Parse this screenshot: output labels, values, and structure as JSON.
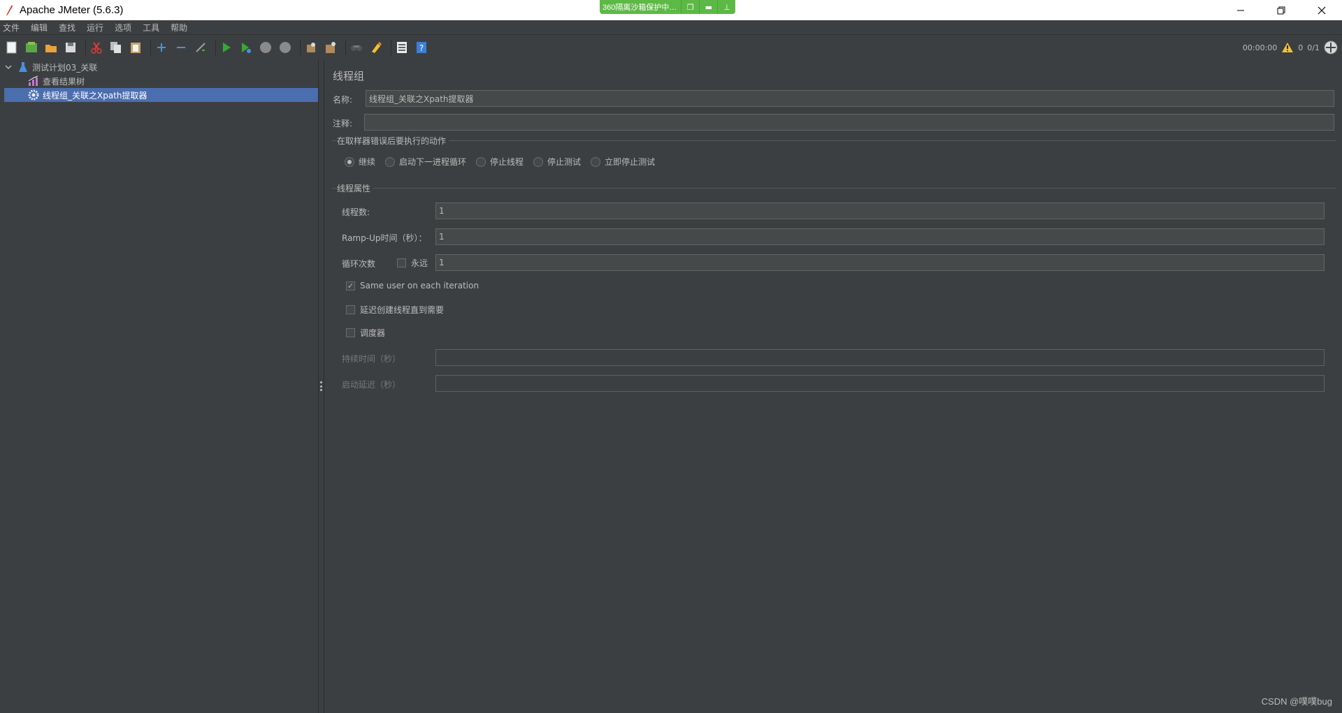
{
  "window": {
    "title": "Apache JMeter (5.6.3)",
    "sandbox_text": "360隔离沙箱保护中…"
  },
  "menu": [
    "文件",
    "编辑",
    "查找",
    "运行",
    "选项",
    "工具",
    "帮助"
  ],
  "toolbar": {
    "icons": [
      "new-icon",
      "templates-icon",
      "open-icon",
      "save-icon",
      "cut-icon",
      "copy-icon",
      "paste-icon",
      "expand-icon",
      "collapse-icon",
      "toggle-icon",
      "start-icon",
      "start-no-pause-icon",
      "stop-icon",
      "shutdown-icon",
      "clear-icon",
      "clear-all-icon",
      "search-icon",
      "reset-search-icon",
      "function-helper-icon",
      "help-icon"
    ],
    "timer": "00:00:00",
    "warning_count": "0",
    "threads": "0/1"
  },
  "tree": {
    "root": "测试计划03_关联",
    "children": [
      "查看结果树",
      "线程组_关联之Xpath提取器"
    ]
  },
  "panel": {
    "title": "线程组",
    "name_label": "名称:",
    "name_value": "线程组_关联之Xpath提取器",
    "comment_label": "注释:",
    "comment_value": "",
    "error_section": "在取样器错误后要执行的动作",
    "error_options": [
      "继续",
      "启动下一进程循环",
      "停止线程",
      "停止测试",
      "立即停止测试"
    ],
    "thread_section": "线程属性",
    "threads_label": "线程数:",
    "threads_value": "1",
    "rampup_label": "Ramp-Up时间（秒）：",
    "rampup_value": "1",
    "loop_label": "循环次数",
    "forever_label": "永远",
    "loop_value": "1",
    "same_user_label": "Same user on each iteration",
    "delay_label": "延迟创建线程直到需要",
    "scheduler_label": "调度器",
    "duration_label": "持续时间（秒）",
    "duration_value": "",
    "startup_delay_label": "启动延迟（秒）",
    "startup_delay_value": ""
  },
  "watermark": "CSDN @噗噗bug"
}
